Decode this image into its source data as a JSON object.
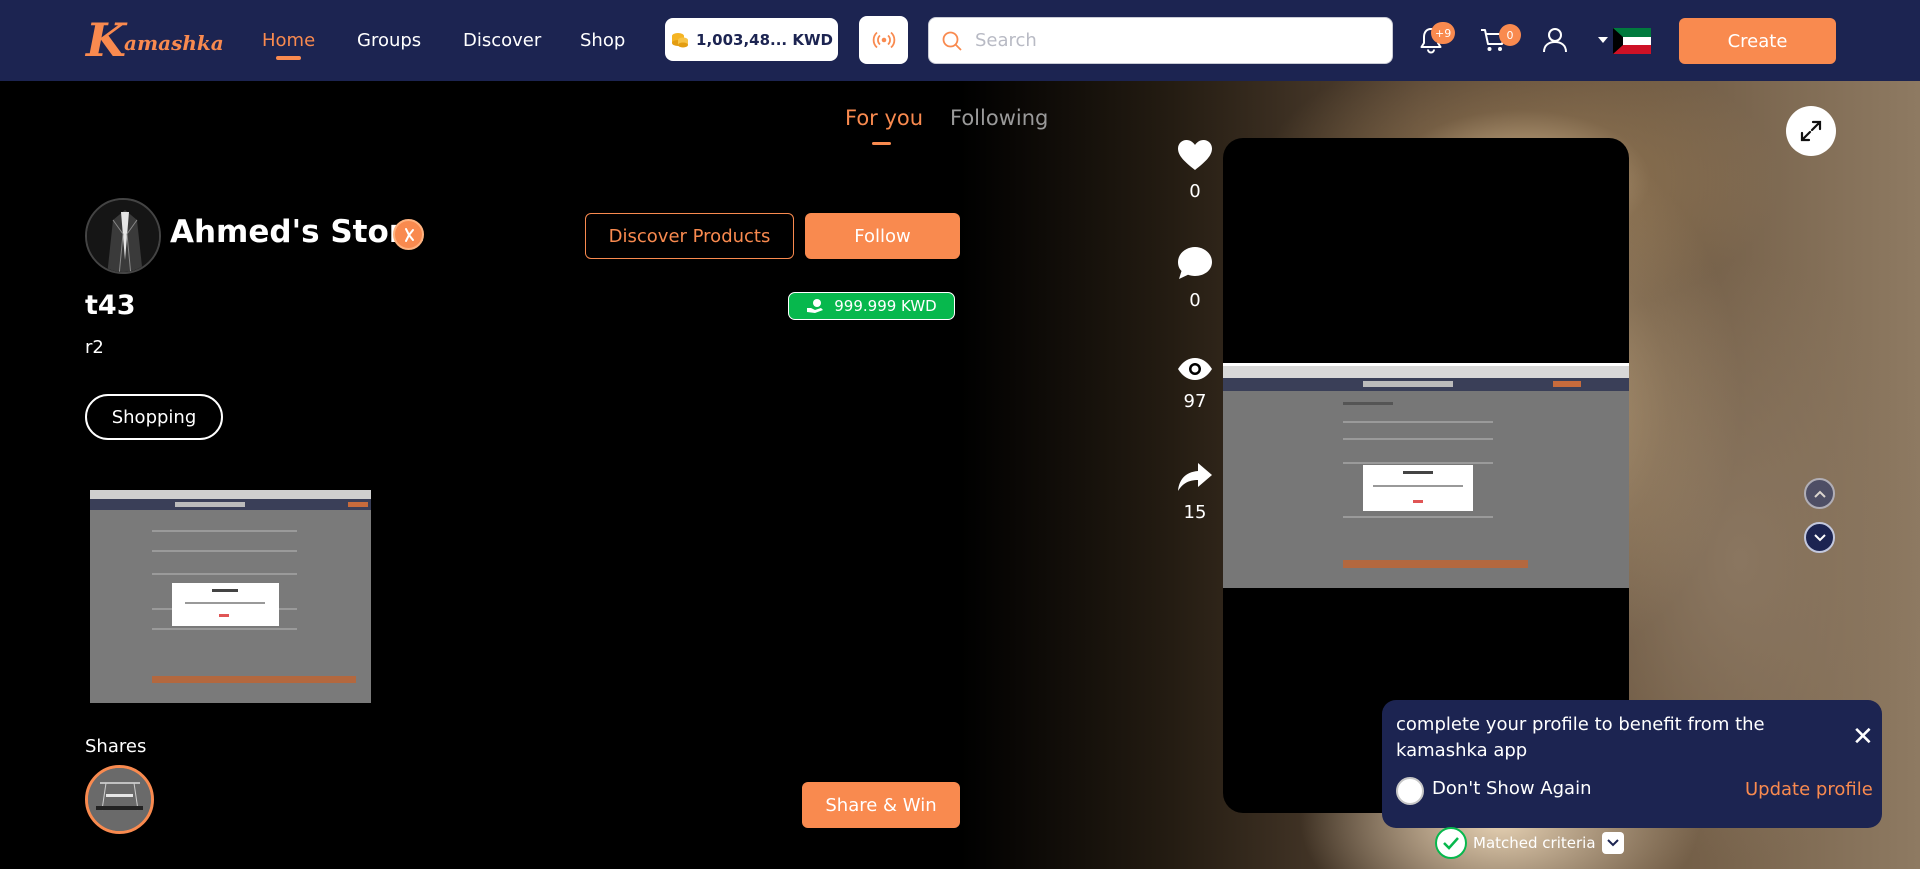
{
  "header": {
    "logo_text": "amashka",
    "logo_initial": "K",
    "nav": [
      "Home",
      "Groups",
      "Discover",
      "Shop"
    ],
    "wallet_balance": "1,003,48... KWD",
    "search_placeholder": "Search",
    "notifications_count": "+9",
    "cart_count": "0",
    "create_label": "Create",
    "active_nav": "Home"
  },
  "feed_tabs": {
    "for_you": "For you",
    "following": "Following",
    "active": "For you"
  },
  "store": {
    "name": "Ahmed's Store",
    "discover_label": "Discover Products",
    "follow_label": "Follow",
    "price": "999.999 KWD"
  },
  "post": {
    "title": "t43",
    "subtitle": "r2",
    "tag": "Shopping",
    "shares_label": "Shares",
    "share_win_label": "Share & Win"
  },
  "actions": {
    "likes": "0",
    "comments": "0",
    "views": "97",
    "shares": "15"
  },
  "toast": {
    "message": "complete your profile to benefit from the kamashka app",
    "dont_show": "Don't Show Again",
    "update_label": "Update profile"
  },
  "matched_label": "Matched criteria",
  "colors": {
    "header_bg": "#1c2451",
    "accent": "#f98a4f",
    "price_green": "#07b84d"
  },
  "icons": {
    "live": "broadcast-icon",
    "bell": "bell-icon",
    "cart": "cart-icon",
    "user": "user-icon",
    "flag": "kuwait-flag-icon"
  }
}
